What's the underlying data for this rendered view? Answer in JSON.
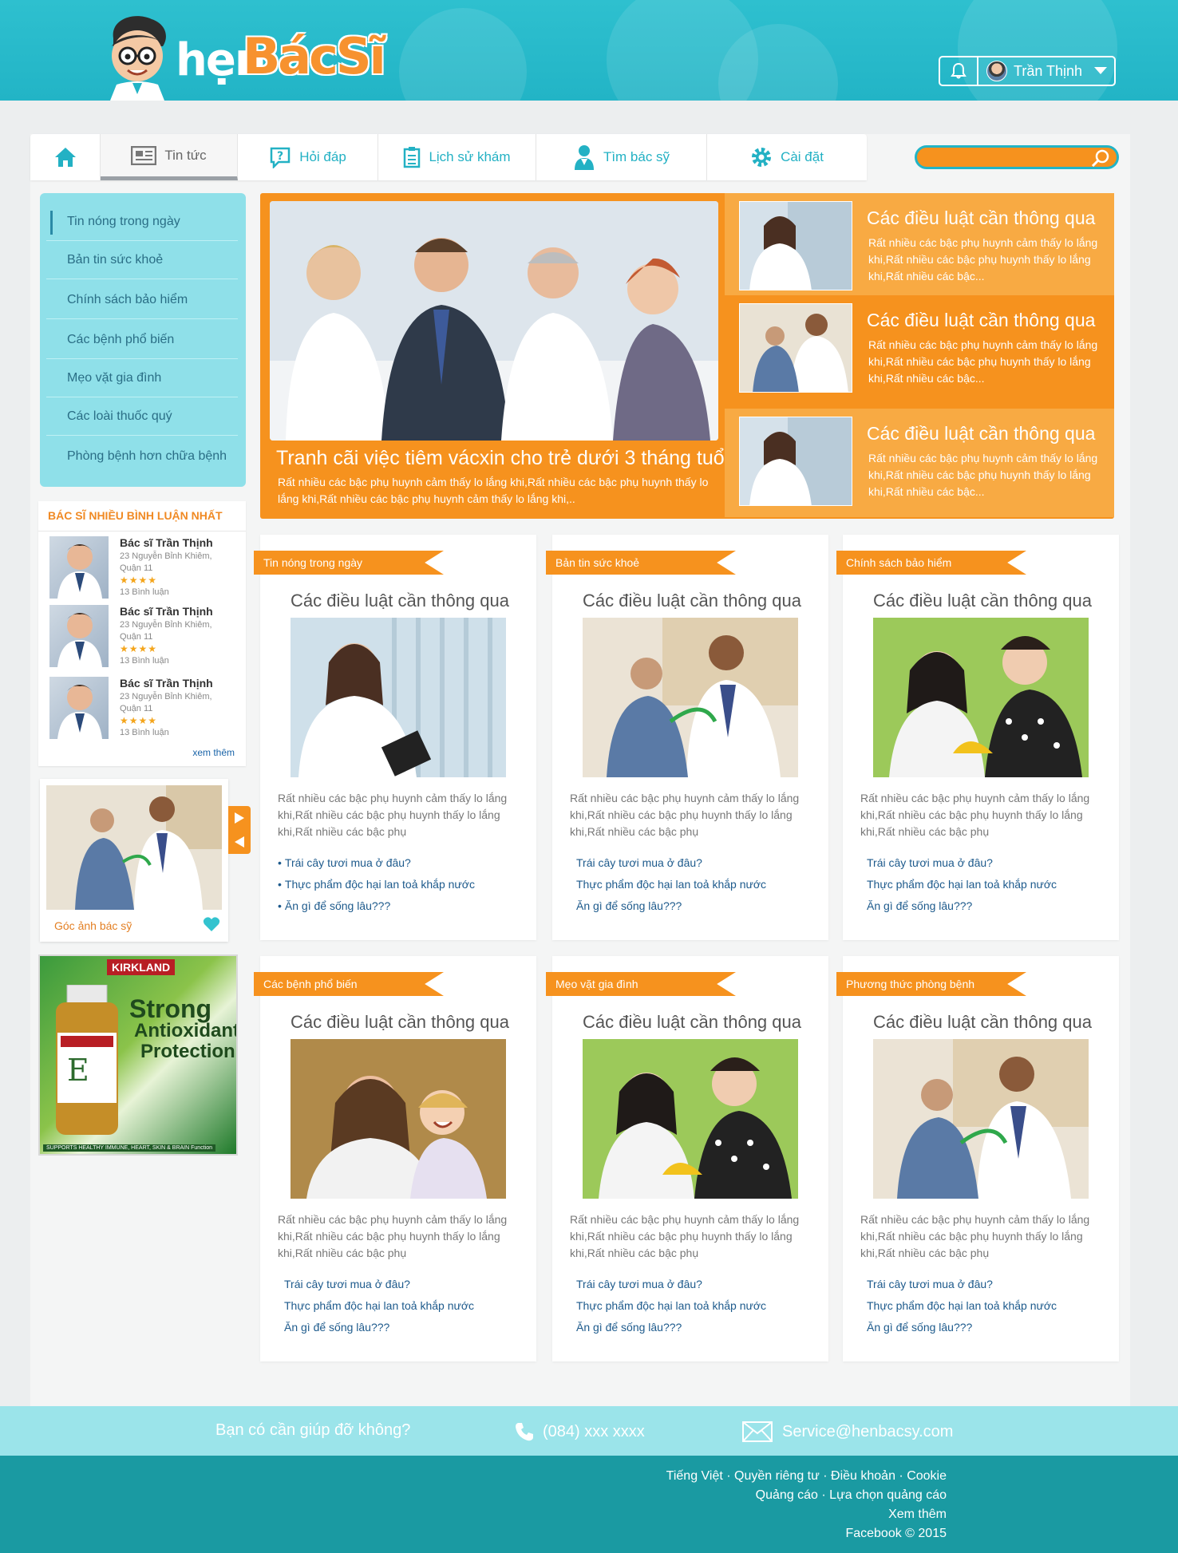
{
  "brand": {
    "part1": "hẹn",
    "part2": "BácSĩ",
    "accent": "#f6921e",
    "teal": "#22b4c6"
  },
  "user": {
    "name": "Trần Thịnh",
    "bell_icon": "bell-icon",
    "caret_icon": "chevron-down-icon"
  },
  "nav": {
    "items": [
      {
        "label": "",
        "icon": "home-icon"
      },
      {
        "label": "Tin tức",
        "icon": "newspaper-icon"
      },
      {
        "label": "Hỏi đáp",
        "icon": "question-bubble-icon"
      },
      {
        "label": "Lịch sử khám",
        "icon": "clipboard-icon"
      },
      {
        "label": "Tìm bác sỹ",
        "icon": "doctor-icon"
      },
      {
        "label": "Cài đặt",
        "icon": "gear-icon"
      }
    ]
  },
  "sidebar": {
    "menu": [
      "Tin nóng trong ngày",
      "Bản tin sức khoẻ",
      "Chính sách bảo hiểm",
      "Các bệnh phổ biến",
      "Mẹo vặt gia đình",
      "Các loài thuốc quý",
      "Phòng bệnh hơn chữa bệnh"
    ],
    "doctors_header": "BÁC SĨ NHIỀU BÌNH LUẬN NHẤT",
    "doctors": [
      {
        "name": "Bác sĩ Trần Thịnh",
        "address": "23 Nguyễn Bỉnh Khiêm, Quận 11",
        "rating": "★★★★",
        "comments": "13 Bình luận"
      },
      {
        "name": "Bác sĩ Trần Thịnh",
        "address": "23 Nguyễn Bỉnh Khiêm, Quận 11",
        "rating": "★★★★",
        "comments": "13 Bình luận"
      },
      {
        "name": "Bác sĩ Trần Thịnh",
        "address": "23 Nguyễn Bỉnh Khiêm, Quận 11",
        "rating": "★★★★",
        "comments": "13 Bình luận"
      }
    ],
    "more": "xem thêm",
    "photo_caption": "Góc ảnh bác sỹ",
    "ad": {
      "brand": "KIRKLAND",
      "l1": "Strong",
      "l2": "Antioxidant",
      "l3": "Protection.",
      "tag": "SUPPORTS HEALTHY IMMUNE, HEART, SKIN & BRAIN Function"
    }
  },
  "hero": {
    "title": "Tranh cãi việc tiêm vácxin cho trẻ dưới 3 tháng tuổi",
    "desc": "Rất nhiều các bậc phụ huynh cảm thấy lo lắng khi,Rất nhiều các bậc phụ huynh thấy lo lắng khi,Rất nhiều các bậc phụ huynh cảm thấy lo lắng khi,..",
    "items": [
      {
        "title": "Các điều luật cần thông qua",
        "desc": "Rất nhiều các bậc phụ huynh cảm thấy lo lắng khi,Rất nhiều các bậc phụ huynh thấy lo lắng khi,Rất nhiều các bậc..."
      },
      {
        "title": "Các điều luật cần thông qua",
        "desc": "Rất nhiều các bậc phụ huynh cảm thấy lo lắng khi,Rất nhiều các bậc phụ huynh thấy lo lắng khi,Rất nhiều các bậc..."
      },
      {
        "title": "Các điều luật cần thông qua",
        "desc": "Rất nhiều các bậc phụ huynh cảm thấy lo lắng khi,Rất nhiều các bậc phụ huynh thấy lo lắng khi,Rất nhiều các bậc..."
      }
    ]
  },
  "cards": [
    {
      "category": "Tin nóng trong ngày",
      "title": "Các điều luật cần thông qua",
      "desc": "Rất nhiều các bậc phụ huynh cảm thấy lo lắng khi,Rất nhiều các bậc phụ huynh thấy lo lắng khi,Rất nhiều các bậc phụ",
      "links": [
        "Trái cây tươi mua ở đâu?",
        "Thực phẩm độc hại lan toả khắp nước",
        "Ăn gì để sống lâu???"
      ]
    },
    {
      "category": "Bản tin sức khoẻ",
      "title": "Các điều luật cần thông qua",
      "desc": "Rất nhiều các bậc phụ huynh cảm thấy lo lắng khi,Rất nhiều các bậc phụ huynh thấy lo lắng khi,Rất nhiều các bậc phụ",
      "links": [
        "Trái cây tươi mua ở đâu?",
        "Thực phẩm độc hại lan toả khắp nước",
        "Ăn gì để sống lâu???"
      ]
    },
    {
      "category": "Chính sách bảo hiểm",
      "title": "Các điều luật cần thông qua",
      "desc": "Rất nhiều các bậc phụ huynh cảm thấy lo lắng khi,Rất nhiều các bậc phụ huynh thấy lo lắng khi,Rất nhiều các bậc phụ",
      "links": [
        "Trái cây tươi mua ở đâu?",
        "Thực phẩm độc hại lan toả khắp nước",
        "Ăn gì để sống lâu???"
      ]
    },
    {
      "category": "Các bệnh phổ biến",
      "title": "Các điều luật cần thông qua",
      "desc": "Rất nhiều các bậc phụ huynh cảm thấy lo lắng khi,Rất nhiều các bậc phụ huynh thấy lo lắng khi,Rất nhiều các bậc phụ",
      "links": [
        "Trái cây tươi mua ở đâu?",
        "Thực phẩm độc hại lan toả khắp nước",
        "Ăn gì để sống lâu???"
      ]
    },
    {
      "category": "Mẹo vặt gia đình",
      "title": "Các điều luật cần thông qua",
      "desc": "Rất nhiều các bậc phụ huynh cảm thấy lo lắng khi,Rất nhiều các bậc phụ huynh thấy lo lắng khi,Rất nhiều các bậc phụ",
      "links": [
        "Trái cây tươi mua ở đâu?",
        "Thực phẩm độc hại lan toả khắp nước",
        "Ăn gì để sống lâu???"
      ]
    },
    {
      "category": "Phương thức phòng bệnh",
      "title": "Các điều luật cần thông qua",
      "desc": "Rất nhiều các bậc phụ huynh cảm thấy lo lắng khi,Rất nhiều các bậc phụ huynh thấy lo lắng khi,Rất nhiều các bậc phụ",
      "links": [
        "Trái cây tươi mua ở đâu?",
        "Thực phẩm độc hại lan toả khắp nước",
        "Ăn gì để sống lâu???"
      ]
    }
  ],
  "help": {
    "question": "Bạn có cần giúp đỡ không?",
    "phone": "(084) xxx xxxx",
    "email": "Service@henbacsy.com"
  },
  "footer": {
    "line1": "Tiếng Việt · Quyền riêng tư · Điều khoản · Cookie",
    "line2": "Quảng cáo · Lựa chọn quảng cáo",
    "line3": "Xem thêm",
    "line4": "Facebook © 2015"
  }
}
